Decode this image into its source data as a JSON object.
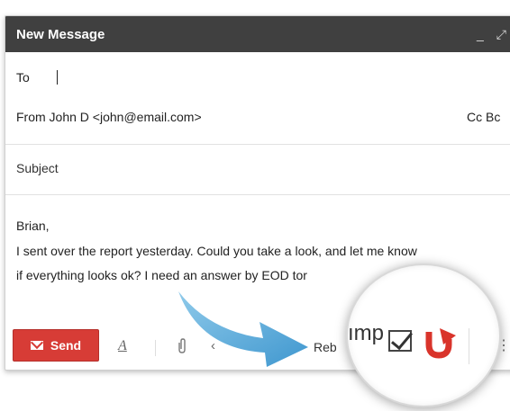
{
  "window": {
    "title": "New Message",
    "minimize_glyph": "_",
    "expand_glyph": "⤢"
  },
  "header": {
    "to_label": "To",
    "from_text": "From  John D <john@email.com>",
    "cc_label": "Cc  Bc",
    "subject_placeholder": "Subject"
  },
  "message": {
    "greeting": "Brian,",
    "line1": "I sent over the report yesterday. Could you take a look, and let me know",
    "line2": "if everything looks ok? I need an answer by EOD tor"
  },
  "toolbar": {
    "send_label": "Send",
    "format_glyph": "A",
    "attach_glyph": "⚲",
    "more_glyph": "‹",
    "rebump_label": "Reb",
    "tail_glyph": "⋮"
  },
  "magnifier": {
    "partial_text": "ımp"
  },
  "colors": {
    "send": "#d73c36",
    "titlebar": "#404040",
    "rebump_logo": "#d9342b",
    "arrow": "#5aaad8"
  },
  "icons": [
    "envelope-icon",
    "text-format-icon",
    "paperclip-icon",
    "checkbox-icon",
    "rebump-logo-icon",
    "minimize-icon",
    "expand-icon"
  ]
}
